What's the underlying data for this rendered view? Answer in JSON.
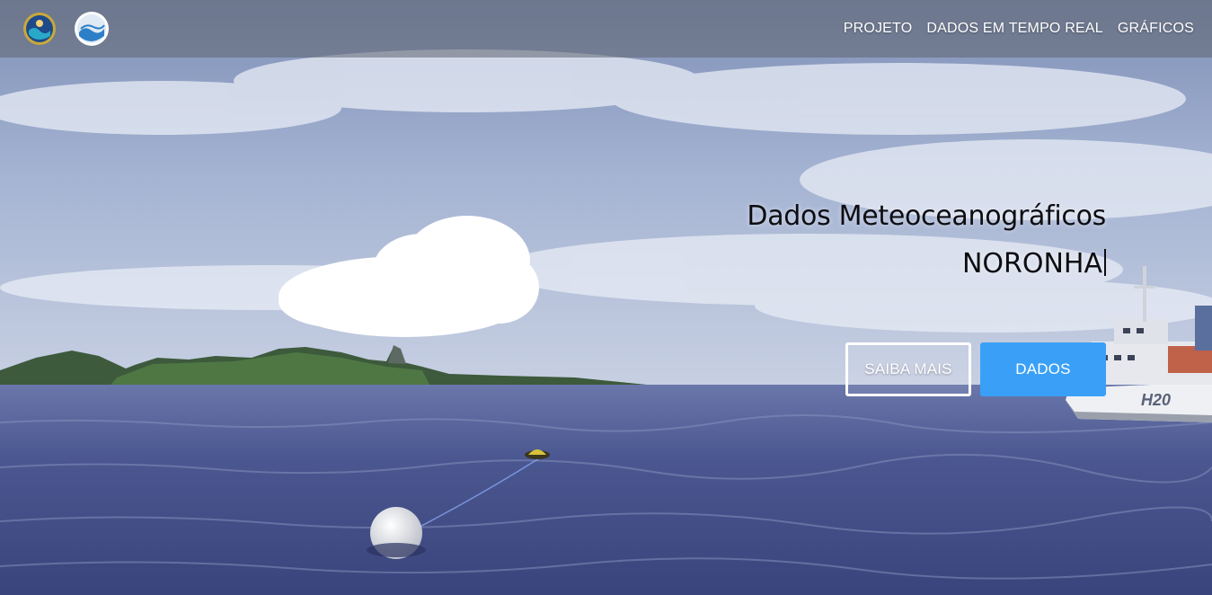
{
  "nav": {
    "logos": [
      {
        "name": "institution-logo-left",
        "icon": "round-emblem-icon"
      },
      {
        "name": "institution-logo-right",
        "icon": "wave-emblem-icon"
      }
    ],
    "links": [
      "PROJETO",
      "DADOS EM TEMPO REAL",
      "GRÁFICOS"
    ]
  },
  "hero": {
    "title": "Dados Meteoceanográficos",
    "subtitle": "NORONHA"
  },
  "buttons": {
    "more_label": "SAIBA MAIS",
    "data_label": "DADOS"
  },
  "ship": {
    "hull_text": "H20"
  },
  "colors": {
    "accent": "#3aa0f7",
    "nav_text": "#ffffff",
    "hero_text": "#0d0d12"
  }
}
